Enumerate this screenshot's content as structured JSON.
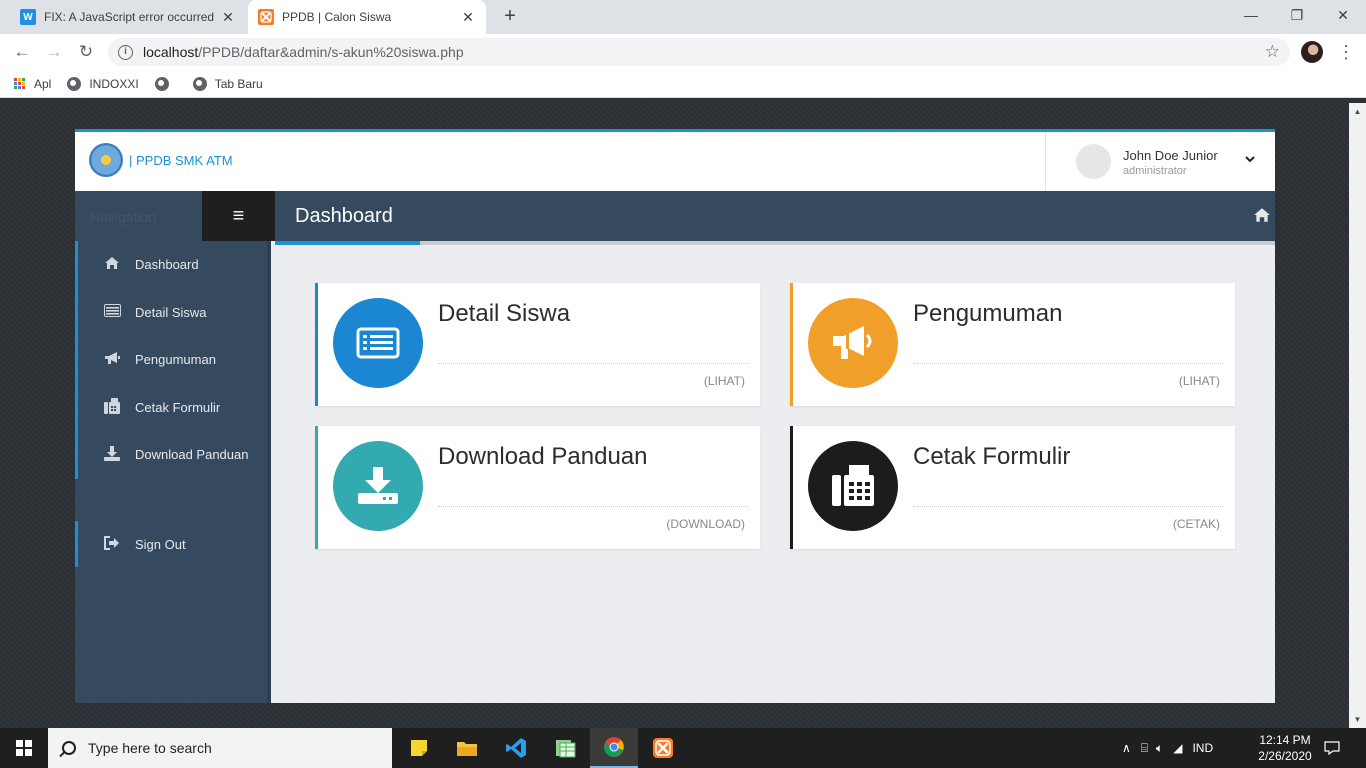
{
  "browser": {
    "tabs": [
      {
        "title": "FIX: A JavaScript error occurred in",
        "favicon": "W",
        "favicon_color": "#1e8fe1"
      },
      {
        "title": "PPDB | Calon Siswa",
        "favicon": "xampp",
        "favicon_color": "#fb7a24"
      }
    ],
    "url_host": "localhost",
    "url_path": "/PPDB/daftar&admin/s-akun%20siswa.php",
    "bookmarks": [
      "Apl",
      "INDOXXI",
      "",
      "Tab Baru"
    ]
  },
  "app": {
    "brand": "| PPDB SMK ATM",
    "user": {
      "name": "John Doe Junior",
      "role": "administrator"
    },
    "nav_title": "Navigation",
    "nav_items": [
      {
        "label": "Dashboard",
        "icon": "home-icon"
      },
      {
        "label": "Detail Siswa",
        "icon": "list-icon"
      },
      {
        "label": "Pengumuman",
        "icon": "bullhorn-icon"
      },
      {
        "label": "Cetak Formulir",
        "icon": "fax-icon"
      },
      {
        "label": "Download Panduan",
        "icon": "download-icon"
      }
    ],
    "sign_out": "Sign Out",
    "page_title": "Dashboard",
    "cards": [
      {
        "title": "Detail Siswa",
        "link": "(LIHAT)",
        "color": "#1b86d1",
        "icon": "list-icon"
      },
      {
        "title": "Pengumuman",
        "link": "(LIHAT)",
        "color": "#f0a02a",
        "icon": "bullhorn-icon"
      },
      {
        "title": "Download Panduan",
        "link": "(DOWNLOAD)",
        "color": "#33aaaf",
        "icon": "download-icon"
      },
      {
        "title": "Cetak Formulir",
        "link": "(CETAK)",
        "color": "#1c1c1c",
        "icon": "fax-icon"
      }
    ]
  },
  "taskbar": {
    "search_placeholder": "Type here to search",
    "language": "IND",
    "time": "12:14 PM",
    "date": "2/26/2020"
  }
}
